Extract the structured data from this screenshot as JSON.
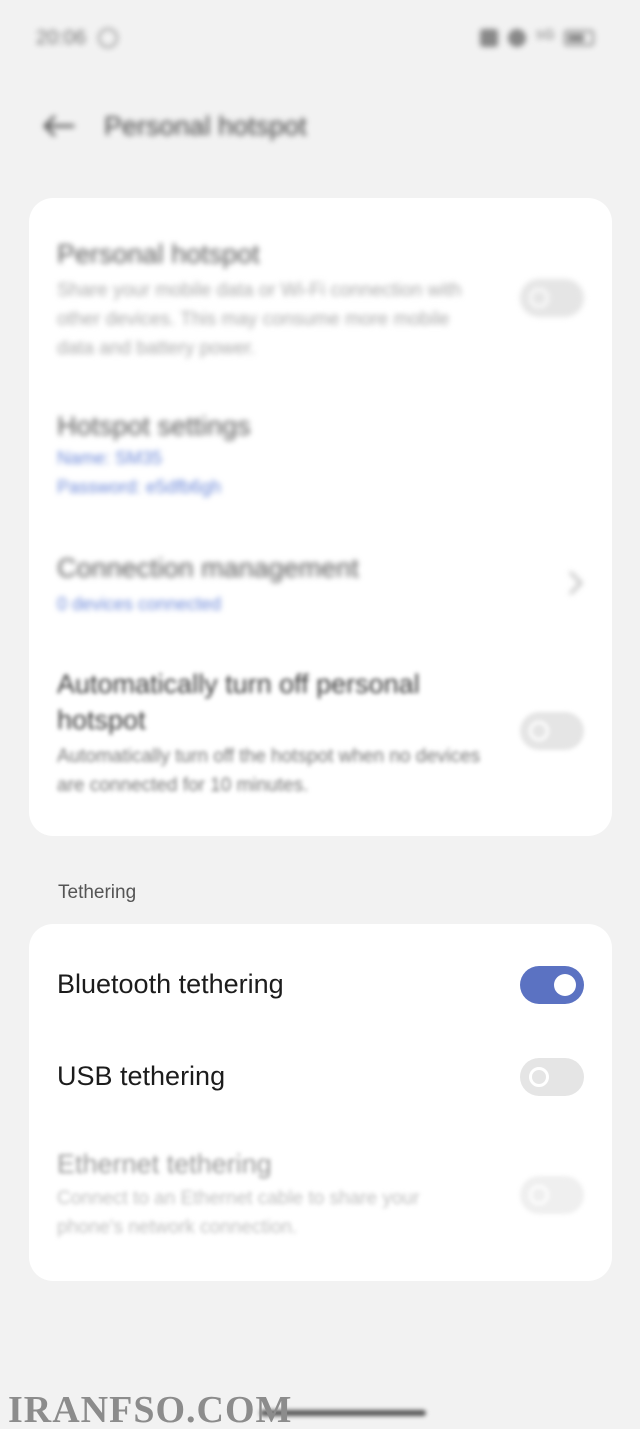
{
  "status_bar": {
    "time": "20:06",
    "signal": "⁵ᴳ"
  },
  "header": {
    "title": "Personal hotspot"
  },
  "hotspot_card": {
    "personal_hotspot": {
      "title": "Personal hotspot",
      "description": "Share your mobile data or Wi-Fi connection with other devices. This may consume more mobile data and battery power.",
      "enabled": false
    },
    "hotspot_settings": {
      "title": "Hotspot settings",
      "name_line": "Name: SM35",
      "password_line": "Password: e5dfb6gh"
    },
    "connection_management": {
      "title": "Connection management",
      "status": "0 devices connected"
    },
    "auto_off": {
      "title": "Automatically turn off personal hotspot",
      "description": "Automatically turn off the hotspot when no devices are connected for 10 minutes.",
      "enabled": false
    }
  },
  "tethering": {
    "section_label": "Tethering",
    "bluetooth": {
      "title": "Bluetooth tethering",
      "enabled": true
    },
    "usb": {
      "title": "USB tethering",
      "enabled": false
    },
    "ethernet": {
      "title": "Ethernet tethering",
      "description": "Connect to an Ethernet cable to share your phone's network connection.",
      "enabled": false
    }
  },
  "watermark": "IRANFSO.COM",
  "colors": {
    "background": "#f2f2f2",
    "card": "#ffffff",
    "accent": "#5b72c2",
    "link_blue": "#6c88d8"
  },
  "icons": {
    "back": "arrow-left-icon",
    "chevron": "chevron-right-icon"
  }
}
